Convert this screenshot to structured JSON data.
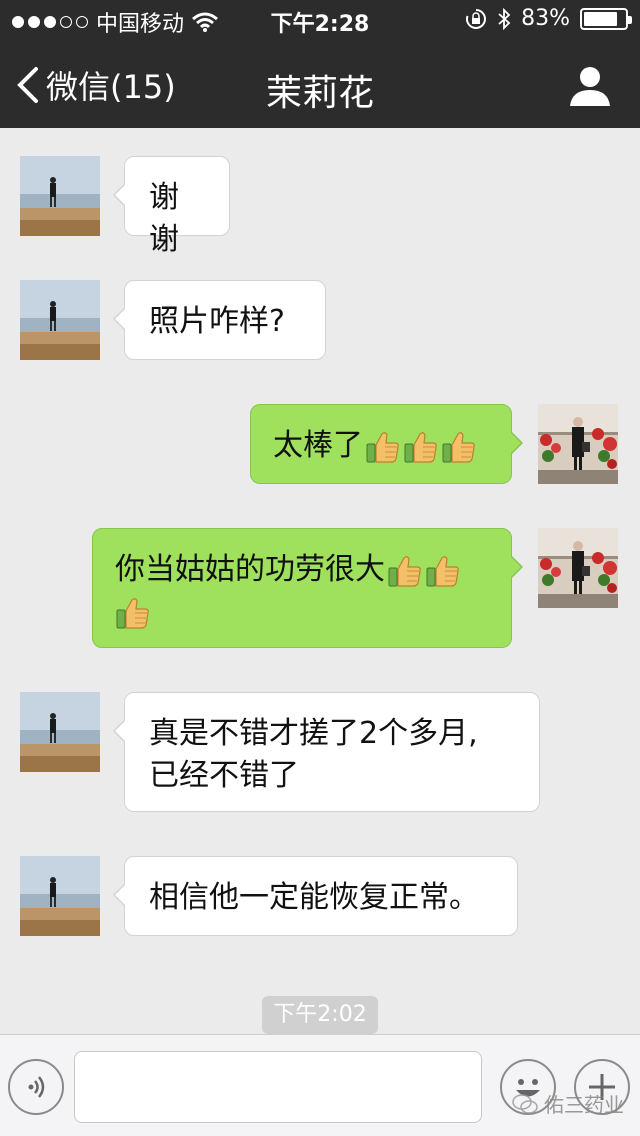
{
  "status_bar": {
    "carrier": "中国移动",
    "time": "下午2:28",
    "battery": "83%",
    "battery_level": 0.83
  },
  "nav": {
    "back_label": "微信(15)",
    "title": "茉莉花"
  },
  "messages": [
    {
      "from": "contact",
      "text": "谢谢",
      "emoji": 0
    },
    {
      "from": "contact",
      "text": "照片咋样?",
      "emoji": 0
    },
    {
      "from": "me",
      "text": "太棒了",
      "emoji": 3
    },
    {
      "from": "me",
      "line1": "你当姑姑的功劳很大",
      "emoji_line1": 2,
      "emoji_line2": 1
    },
    {
      "from": "contact",
      "line1": "真是不错才搓了2个多月,",
      "line2": "已经不错了"
    },
    {
      "from": "contact",
      "text": "相信他一定能恢复正常。",
      "emoji": 0
    }
  ],
  "timestamp": "下午2:02",
  "input": {
    "value": "",
    "placeholder": ""
  },
  "icons": {
    "voice": "voice-icon",
    "emoji_picker": "emoji-face-icon",
    "more": "plus-icon",
    "thumbs_up": "thumbs-up-icon"
  },
  "watermark": "佑三药业",
  "colors": {
    "bar": "#2c2c2c",
    "outgoing_bubble": "#9fe05d",
    "incoming_bubble": "#ffffff",
    "background": "#ebebeb"
  }
}
